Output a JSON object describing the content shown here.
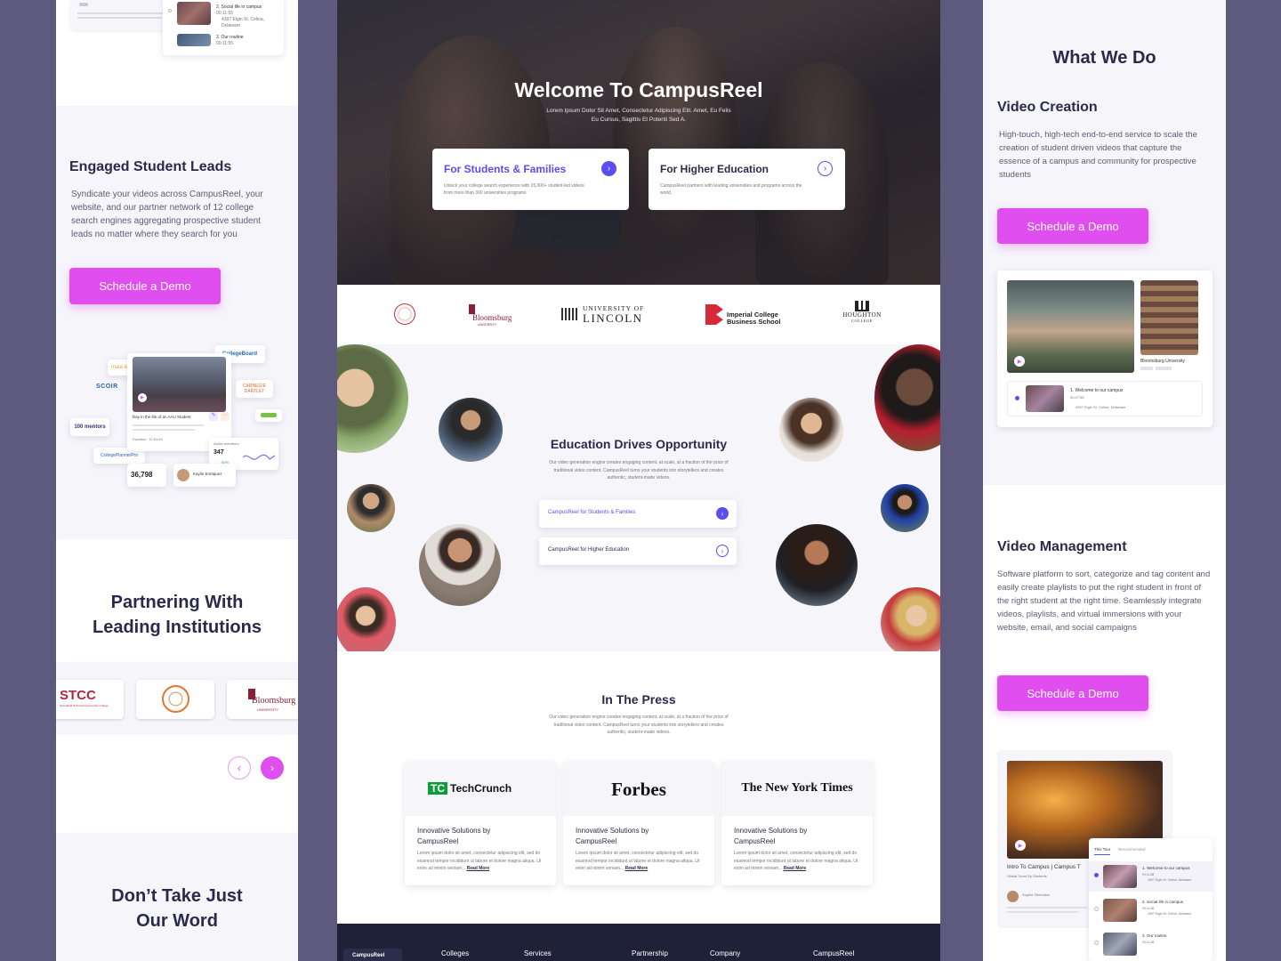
{
  "left": {
    "top_list": {
      "items": [
        {
          "title": "2. Social life in campus",
          "meta": "00:11:55",
          "address": "4397 Elgin St. Celina, Delaware"
        },
        {
          "title": "3. Our routine",
          "meta": "00:11:55"
        }
      ]
    },
    "leads": {
      "title": "Engaged Student Leads",
      "body": "Syndicate your videos across CampusReel, your website, and our partner network of 12 college search engines aggregating prospective student leads no matter where they search for you",
      "button": "Schedule a Demo"
    },
    "collage": {
      "partners": [
        "maia learning",
        "SCOIR",
        "100 mentors",
        "CollegePlannerPro",
        "CollegeBoard",
        "CARNEGIE DARTLET"
      ],
      "video_caption": "Day in the life of an AAU Student",
      "duration": "Duration : 11:51:49",
      "active_label": "Active members",
      "active_value": "347",
      "active_change": "50%",
      "total": "36,798",
      "person": "Kaylin Enrtiquez"
    },
    "partnering": {
      "title_line1": "Partnering With",
      "title_line2": "Leading Institutions",
      "logos": [
        "STCC",
        "Springfield Technical Community College",
        "Bloomsburg",
        "UNIVERSITY"
      ]
    },
    "testimonial": {
      "title_line1": "Don’t Take Just",
      "title_line2": "Our Word"
    }
  },
  "center": {
    "hero": {
      "title": "Welcome To CampusReel",
      "subtitle": "Lorem Ipsum Dolor Sit Amet, Consectetur Adipiscing Elit. Amet, Eu Felis Eu Cursus, Sagittis Et Potenti Sed A.",
      "cards": [
        {
          "title": "For Students & Families",
          "body": "Unlock your college search experience with 15,000+ student-led videos from more than 300 universities programs"
        },
        {
          "title": "For Higher Education",
          "body": "CampusReel partners with leading universities and programs across the world."
        }
      ]
    },
    "logos": {
      "bloomsburg": "Bloomsburg",
      "bloomsburg_sub": "UNIVERSITY",
      "lincoln_line1": "UNIVERSITY OF",
      "lincoln_line2": "LINCOLN",
      "imperial_line1": "Imperial College",
      "imperial_line2": "Business School",
      "houghton_line1": "HOUGHTON",
      "houghton_line2": "COLLEGE"
    },
    "education": {
      "title": "Education Drives Opportunity",
      "body": "Our video generation engine creates engaging content, at scale, at a fraction of the price of traditional video content. CampusReel turns your students into storytellers and creates authentic, student-made videos.",
      "links": [
        "CampusReel for Students & Families",
        "CampusReel for Higher Education"
      ]
    },
    "press": {
      "title": "In The Press",
      "body": "Our video generation engine creates engaging content, at scale, at a fraction of the price of traditional video content. CampusReel turns your students into storytellers and creates authentic, student-made videos.",
      "cards": [
        {
          "logo": "TechCrunch",
          "title": "Innovative Solutions by CampusReel",
          "body": "Lorem ipsum dolor sit amet, consectetur adipiscing elit, sed do eiusmod tempor incididunt ut labore et dolore magna aliqua. Ut enim ad minim veniam...",
          "link": "Read More"
        },
        {
          "logo": "Forbes",
          "title": "Innovative Solutions by CampusReel",
          "body": "Lorem ipsum dolor sit amet, consectetur adipiscing elit, sed do eiusmod tempor incididunt ut labore et dolore magna aliqua. Ut enim ad minim veniam...",
          "link": "Read More"
        },
        {
          "logo": "The New York Times",
          "title": "Innovative Solutions by CampusReel",
          "body": "Lorem ipsum dolor sit amet, consectetur adipiscing elit, sed do eiusmod tempor incididunt ut labore et dolore magna aliqua. Ut enim ad minim veniam...",
          "link": "Read More"
        }
      ]
    },
    "footer": {
      "brand": "CampusReel",
      "columns": [
        "Colleges",
        "Services",
        "Partnership",
        "Company",
        "CampusReel"
      ]
    }
  },
  "right": {
    "title": "What We Do",
    "creation": {
      "title": "Video Creation",
      "body": "High-touch, high-tech end-to-end service to scale the creation of student driven videos that capture the essence of a campus and community for prospective students",
      "button": "Schedule a Demo",
      "card": {
        "school": "Bloomsburg University",
        "item": "1. Welcome to our campus",
        "item_meta": "00:07:58",
        "address": "4397 Elgin St. Celina, Delaware"
      }
    },
    "management": {
      "title": "Video Management",
      "body": "Software platform to sort, categorize and tag content and easily create playlists to put the right student in front of the right student at the right time. Seamlessly integrate videos, playlists, and virtual immersions with your website, email, and social campaigns",
      "button": "Schedule a Demo",
      "card": {
        "caption": "Intro To Campus | Campus T",
        "sub": "Virtual Tours By Students",
        "person": "Sophie Germaine",
        "tabs": [
          "This Tour",
          "Recommended"
        ],
        "items": [
          {
            "title": "1. Welcome to our campus",
            "meta": "00:11:58",
            "address": "4397 Elgin St. Celina, Delaware"
          },
          {
            "title": "2. Social life in campus",
            "meta": "00:11:58",
            "address": "4397 Elgin St. Celina, Delaware"
          },
          {
            "title": "3. Our routine",
            "meta": "00:11:58"
          }
        ]
      }
    }
  },
  "colors": {
    "accent": "#e14ef0",
    "brand_blue": "#5b4ef0",
    "background": "#5d5a7e",
    "text": "#2c2a4a"
  }
}
